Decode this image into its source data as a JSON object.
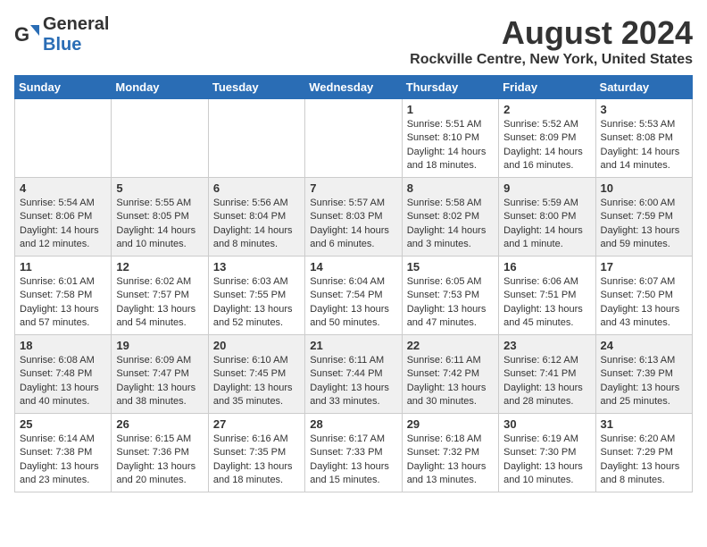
{
  "header": {
    "logo_general": "General",
    "logo_blue": "Blue",
    "month_title": "August 2024",
    "location": "Rockville Centre, New York, United States"
  },
  "days_of_week": [
    "Sunday",
    "Monday",
    "Tuesday",
    "Wednesday",
    "Thursday",
    "Friday",
    "Saturday"
  ],
  "weeks": [
    [
      {
        "day": "",
        "info": ""
      },
      {
        "day": "",
        "info": ""
      },
      {
        "day": "",
        "info": ""
      },
      {
        "day": "",
        "info": ""
      },
      {
        "day": "1",
        "info": "Sunrise: 5:51 AM\nSunset: 8:10 PM\nDaylight: 14 hours\nand 18 minutes."
      },
      {
        "day": "2",
        "info": "Sunrise: 5:52 AM\nSunset: 8:09 PM\nDaylight: 14 hours\nand 16 minutes."
      },
      {
        "day": "3",
        "info": "Sunrise: 5:53 AM\nSunset: 8:08 PM\nDaylight: 14 hours\nand 14 minutes."
      }
    ],
    [
      {
        "day": "4",
        "info": "Sunrise: 5:54 AM\nSunset: 8:06 PM\nDaylight: 14 hours\nand 12 minutes."
      },
      {
        "day": "5",
        "info": "Sunrise: 5:55 AM\nSunset: 8:05 PM\nDaylight: 14 hours\nand 10 minutes."
      },
      {
        "day": "6",
        "info": "Sunrise: 5:56 AM\nSunset: 8:04 PM\nDaylight: 14 hours\nand 8 minutes."
      },
      {
        "day": "7",
        "info": "Sunrise: 5:57 AM\nSunset: 8:03 PM\nDaylight: 14 hours\nand 6 minutes."
      },
      {
        "day": "8",
        "info": "Sunrise: 5:58 AM\nSunset: 8:02 PM\nDaylight: 14 hours\nand 3 minutes."
      },
      {
        "day": "9",
        "info": "Sunrise: 5:59 AM\nSunset: 8:00 PM\nDaylight: 14 hours\nand 1 minute."
      },
      {
        "day": "10",
        "info": "Sunrise: 6:00 AM\nSunset: 7:59 PM\nDaylight: 13 hours\nand 59 minutes."
      }
    ],
    [
      {
        "day": "11",
        "info": "Sunrise: 6:01 AM\nSunset: 7:58 PM\nDaylight: 13 hours\nand 57 minutes."
      },
      {
        "day": "12",
        "info": "Sunrise: 6:02 AM\nSunset: 7:57 PM\nDaylight: 13 hours\nand 54 minutes."
      },
      {
        "day": "13",
        "info": "Sunrise: 6:03 AM\nSunset: 7:55 PM\nDaylight: 13 hours\nand 52 minutes."
      },
      {
        "day": "14",
        "info": "Sunrise: 6:04 AM\nSunset: 7:54 PM\nDaylight: 13 hours\nand 50 minutes."
      },
      {
        "day": "15",
        "info": "Sunrise: 6:05 AM\nSunset: 7:53 PM\nDaylight: 13 hours\nand 47 minutes."
      },
      {
        "day": "16",
        "info": "Sunrise: 6:06 AM\nSunset: 7:51 PM\nDaylight: 13 hours\nand 45 minutes."
      },
      {
        "day": "17",
        "info": "Sunrise: 6:07 AM\nSunset: 7:50 PM\nDaylight: 13 hours\nand 43 minutes."
      }
    ],
    [
      {
        "day": "18",
        "info": "Sunrise: 6:08 AM\nSunset: 7:48 PM\nDaylight: 13 hours\nand 40 minutes."
      },
      {
        "day": "19",
        "info": "Sunrise: 6:09 AM\nSunset: 7:47 PM\nDaylight: 13 hours\nand 38 minutes."
      },
      {
        "day": "20",
        "info": "Sunrise: 6:10 AM\nSunset: 7:45 PM\nDaylight: 13 hours\nand 35 minutes."
      },
      {
        "day": "21",
        "info": "Sunrise: 6:11 AM\nSunset: 7:44 PM\nDaylight: 13 hours\nand 33 minutes."
      },
      {
        "day": "22",
        "info": "Sunrise: 6:11 AM\nSunset: 7:42 PM\nDaylight: 13 hours\nand 30 minutes."
      },
      {
        "day": "23",
        "info": "Sunrise: 6:12 AM\nSunset: 7:41 PM\nDaylight: 13 hours\nand 28 minutes."
      },
      {
        "day": "24",
        "info": "Sunrise: 6:13 AM\nSunset: 7:39 PM\nDaylight: 13 hours\nand 25 minutes."
      }
    ],
    [
      {
        "day": "25",
        "info": "Sunrise: 6:14 AM\nSunset: 7:38 PM\nDaylight: 13 hours\nand 23 minutes."
      },
      {
        "day": "26",
        "info": "Sunrise: 6:15 AM\nSunset: 7:36 PM\nDaylight: 13 hours\nand 20 minutes."
      },
      {
        "day": "27",
        "info": "Sunrise: 6:16 AM\nSunset: 7:35 PM\nDaylight: 13 hours\nand 18 minutes."
      },
      {
        "day": "28",
        "info": "Sunrise: 6:17 AM\nSunset: 7:33 PM\nDaylight: 13 hours\nand 15 minutes."
      },
      {
        "day": "29",
        "info": "Sunrise: 6:18 AM\nSunset: 7:32 PM\nDaylight: 13 hours\nand 13 minutes."
      },
      {
        "day": "30",
        "info": "Sunrise: 6:19 AM\nSunset: 7:30 PM\nDaylight: 13 hours\nand 10 minutes."
      },
      {
        "day": "31",
        "info": "Sunrise: 6:20 AM\nSunset: 7:29 PM\nDaylight: 13 hours\nand 8 minutes."
      }
    ]
  ],
  "alt_rows": [
    1,
    3
  ]
}
